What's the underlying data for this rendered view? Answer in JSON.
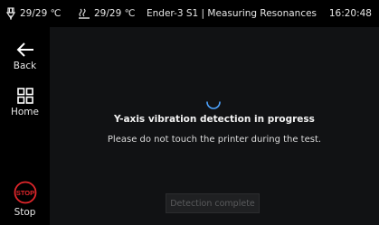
{
  "status_bar": {
    "nozzle_temp": "29/29 ℃",
    "bed_temp": "29/29 ℃",
    "title": "Ender-3 S1 | Measuring Resonances",
    "time": "16:20:48"
  },
  "sidebar": {
    "back_label": "Back",
    "home_label": "Home",
    "stop_label": "Stop",
    "stop_icon_text": "STOP"
  },
  "main": {
    "progress_title": "Y-axis vibration detection in progress",
    "progress_subtitle": "Please do not touch the printer during the test.",
    "complete_button": "Detection complete"
  },
  "colors": {
    "accent": "#4da3ff",
    "stop_red": "#e0262b",
    "background": "#000000",
    "panel": "#111214"
  },
  "icons": [
    "nozzle-icon",
    "bed-icon",
    "arrow-left-icon",
    "grid-icon",
    "stop-icon",
    "spinner-icon"
  ]
}
